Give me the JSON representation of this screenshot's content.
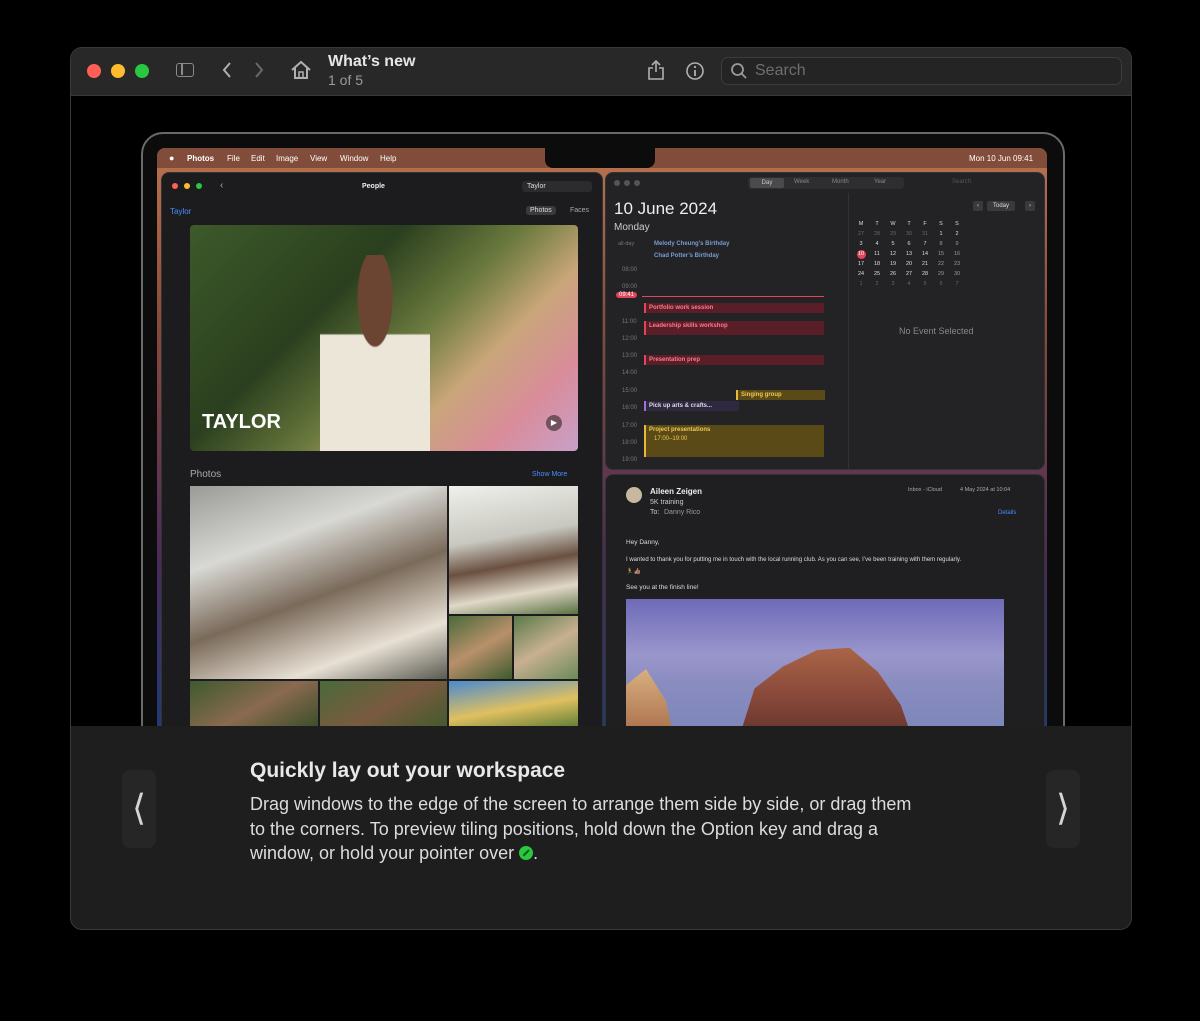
{
  "window": {
    "title": "What’s new",
    "subtitle": "1 of 5",
    "search_placeholder": "Search"
  },
  "screen": {
    "menubar": {
      "app": "Photos",
      "items": [
        "File",
        "Edit",
        "Image",
        "View",
        "Window",
        "Help"
      ],
      "clock": "Mon 10 Jun  09:41"
    },
    "photos": {
      "title": "People",
      "search_value": "Taylor",
      "person": "Taylor",
      "tabs": [
        "Photos",
        "Faces"
      ],
      "hero_label": "TAYLOR",
      "section": "Photos",
      "show_more": "Show More"
    },
    "calendar": {
      "view_tabs": [
        "Day",
        "Week",
        "Month",
        "Year"
      ],
      "search_placeholder": "Search",
      "date": "10 June 2024",
      "weekday": "Monday",
      "allday_label": "all-day",
      "allday_events": [
        "Melody Cheung’s Birthday",
        "Chad Potter’s Birthday"
      ],
      "hours": [
        "08:00",
        "09:00",
        "11:00",
        "12:00",
        "13:00",
        "14:00",
        "15:00",
        "16:00",
        "17:00",
        "18:00",
        "19:00"
      ],
      "now_time": "09:41",
      "events": [
        {
          "name": "Portfolio work session",
          "color": "#e0455a"
        },
        {
          "name": "Leadership skills workshop",
          "color": "#e0455a"
        },
        {
          "name": "Presentation prep",
          "color": "#e0455a"
        },
        {
          "name": "Singing group",
          "color": "#e8b93a"
        },
        {
          "name": "Pick up arts & crafts...",
          "color": "#a070e0"
        },
        {
          "name": "Project presentations",
          "color": "#e8b93a"
        }
      ],
      "event_time": "17:00–19:00",
      "today_button": "Today",
      "weekdays": [
        "M",
        "T",
        "W",
        "T",
        "F",
        "S",
        "S"
      ],
      "month_rows": [
        [
          "27",
          "28",
          "29",
          "30",
          "31",
          "1",
          "2"
        ],
        [
          "3",
          "4",
          "5",
          "6",
          "7",
          "8",
          "9"
        ],
        [
          "10",
          "11",
          "12",
          "13",
          "14",
          "15",
          "16"
        ],
        [
          "17",
          "18",
          "19",
          "20",
          "21",
          "22",
          "23"
        ],
        [
          "24",
          "25",
          "26",
          "27",
          "28",
          "29",
          "30"
        ],
        [
          "1",
          "2",
          "3",
          "4",
          "5",
          "6",
          "7"
        ]
      ],
      "no_event": "No Event Selected"
    },
    "mail": {
      "sender": "Aileen Zeigen",
      "subject": "5K training",
      "to_label": "To:",
      "to": "Danny Rico",
      "mailbox": "Inbox - iCloud",
      "date": "4 May 2024 at 10:04",
      "details": "Details",
      "greeting": "Hey Danny,",
      "body": "I wanted to thank you for putting me in touch with the local running club. As you can see, I’ve been training with them regularly.",
      "emoji": "🏃👍🏽",
      "closing": "See you at the finish line!"
    }
  },
  "tip": {
    "heading": "Quickly lay out your workspace",
    "body": "Drag windows to the edge of the screen to arrange them side by side, or drag them to the corners. To preview tiling positions, hold down the Option key and drag a window, or hold your pointer over",
    "end": ".",
    "prev": "⟨",
    "next": "⟩"
  },
  "colors": {
    "close": "#ff5f57",
    "minimize": "#febc2e",
    "zoom": "#28c840"
  }
}
